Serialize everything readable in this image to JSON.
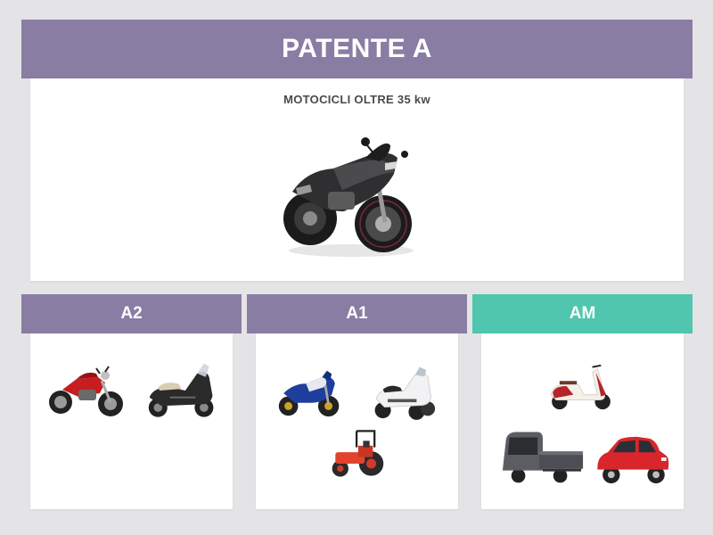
{
  "colors": {
    "header_purple": "#8a7da3",
    "header_teal": "#4fc6ad",
    "card_bg": "#ffffff",
    "page_bg": "#e4e3e5"
  },
  "main": {
    "title": "PATENTE A",
    "subtitle": "MOTOCICLI OLTRE 35 kw",
    "image": "sport-motorcycle-black"
  },
  "categories": [
    {
      "label": "A2",
      "vehicles": [
        "naked-motorcycle-red",
        "maxi-scooter-black"
      ]
    },
    {
      "label": "A1",
      "vehicles": [
        "sport-motorcycle-blue",
        "three-wheel-scooter-white",
        "tractor-red"
      ]
    },
    {
      "label": "AM",
      "vehicles": [
        "vespa-scooter-red",
        "ape-three-wheeler-grey",
        "microcar-red"
      ]
    }
  ]
}
